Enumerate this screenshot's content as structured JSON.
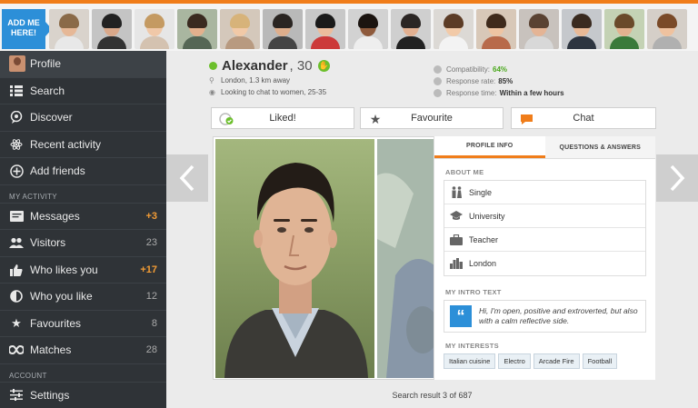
{
  "strip": {
    "add_me_label": "ADD ME HERE!",
    "avatars": [
      {
        "skin": "#e6b897",
        "hair": "#8a6a48",
        "shirt": "#e8e8e8",
        "bg": "#d9d3cc"
      },
      {
        "skin": "#d9a88a",
        "hair": "#222222",
        "shirt": "#333333",
        "bg": "#c4c4c4"
      },
      {
        "skin": "#f0c8a8",
        "hair": "#c49a62",
        "shirt": "#d4c2b0",
        "bg": "#e6e6e6"
      },
      {
        "skin": "#e3b08d",
        "hair": "#3a2a20",
        "shirt": "#556655",
        "bg": "#a9b6a0"
      },
      {
        "skin": "#f1c9a7",
        "hair": "#d7b37a",
        "shirt": "#b89a80",
        "bg": "#d4c8bb"
      },
      {
        "skin": "#deae8c",
        "hair": "#2a2522",
        "shirt": "#444444",
        "bg": "#b9b9b9"
      },
      {
        "skin": "#ecbc9c",
        "hair": "#1a1a1a",
        "shirt": "#cc3a3a",
        "bg": "#c8c8c8"
      },
      {
        "skin": "#8e5a3c",
        "hair": "#1b1410",
        "shirt": "#eeeeee",
        "bg": "#d2d2d2"
      },
      {
        "skin": "#e2b091",
        "hair": "#2b2624",
        "shirt": "#222222",
        "bg": "#cfcfcf"
      },
      {
        "skin": "#f2caa8",
        "hair": "#5c3c26",
        "shirt": "#f3f3f3",
        "bg": "#dcd9d5"
      },
      {
        "skin": "#eec4a2",
        "hair": "#3f2a1c",
        "shirt": "#b86a4a",
        "bg": "#d8c8b8"
      },
      {
        "skin": "#e4b495",
        "hair": "#5a4232",
        "shirt": "#d8d8d8",
        "bg": "#c8c2bd"
      },
      {
        "skin": "#e8b996",
        "hair": "#3a2b20",
        "shirt": "#2d3540",
        "bg": "#c5c8cc"
      },
      {
        "skin": "#e3b28f",
        "hair": "#6a4a2a",
        "shirt": "#3a7a3a",
        "bg": "#c4d2b4"
      },
      {
        "skin": "#efc29f",
        "hair": "#7a4a28",
        "shirt": "#b0b0b0",
        "bg": "#d5cfc8"
      }
    ]
  },
  "sidebar": {
    "items": [
      {
        "label": "Profile",
        "icon": "avatar"
      },
      {
        "label": "Search",
        "icon": "list-icon"
      },
      {
        "label": "Discover",
        "icon": "chat-icon"
      },
      {
        "label": "Recent activity",
        "icon": "atom-icon"
      },
      {
        "label": "Add friends",
        "icon": "plus-circle-icon"
      }
    ],
    "my_activity_header": "MY ACTIVITY",
    "activity": [
      {
        "label": "Messages",
        "count": "+3",
        "hot": true,
        "icon": "message-icon"
      },
      {
        "label": "Visitors",
        "count": "23",
        "hot": false,
        "icon": "visitors-icon"
      },
      {
        "label": "Who likes you",
        "count": "+17",
        "hot": true,
        "icon": "thumb-icon"
      },
      {
        "label": "Who you like",
        "count": "12",
        "hot": false,
        "icon": "heart-half-icon"
      },
      {
        "label": "Favourites",
        "count": "8",
        "hot": false,
        "icon": "star-icon"
      },
      {
        "label": "Matches",
        "count": "28",
        "hot": false,
        "icon": "infinity-icon"
      }
    ],
    "account_header": "ACCOUNT",
    "settings_label": "Settings"
  },
  "profile": {
    "name": "Alexander",
    "age": ", 30",
    "location": "London, 1.3 km away",
    "looking_for": "Looking to chat to women, 25-35",
    "compatibility_label": "Compatibility:",
    "compatibility_value": "64%",
    "response_rate_label": "Response rate:",
    "response_rate_value": "85%",
    "response_time_label": "Response time:",
    "response_time_value": "Within a few hours"
  },
  "actions": {
    "liked": "Liked!",
    "favourite": "Favourite",
    "chat": "Chat"
  },
  "panel": {
    "tab_profile": "PROFILE INFO",
    "tab_qa": "QUESTIONS & ANSWERS",
    "about_title": "ABOUT ME",
    "about": [
      {
        "label": "Single",
        "icon": "people-icon"
      },
      {
        "label": "University",
        "icon": "graduation-cap-icon"
      },
      {
        "label": "Teacher",
        "icon": "briefcase-icon"
      },
      {
        "label": "London",
        "icon": "city-icon"
      }
    ],
    "intro_title": "MY INTRO TEXT",
    "intro_text": "Hi, I'm open, positive and extroverted, but also with a calm reflective side.",
    "interests_title": "MY INTERESTS",
    "interests": [
      "Italian cuisine",
      "Electro",
      "Arcade Fire",
      "Football"
    ]
  },
  "footer": {
    "result_text": "Search result 3 of 687"
  },
  "colors": {
    "accent": "#f07d1a",
    "online": "#6cbf2c",
    "link_blue": "#2c8fd8",
    "sidebar_bg": "#2f3337"
  }
}
